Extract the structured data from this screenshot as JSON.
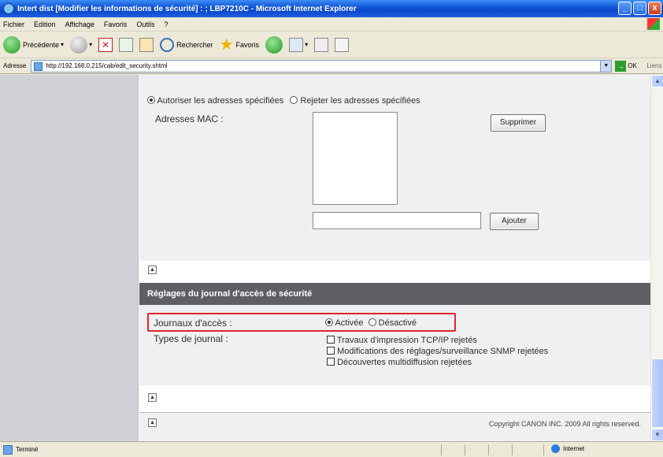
{
  "window": {
    "title": "Intert dist [Modifier les informations de sécurité] : ; LBP7210C - Microsoft Internet Explorer",
    "btn_min": "_",
    "btn_max": "□",
    "btn_close": "x"
  },
  "menu": [
    "Fichier",
    "Edition",
    "Affichage",
    "Favoris",
    "Outils",
    "?"
  ],
  "toolbar": {
    "back_label": "Précédente",
    "search_label": "Rechercher",
    "favorites_label": "Favoris"
  },
  "addressbar": {
    "label": "Adresse",
    "url": "http://192.168.0.215/cab/edit_security.shtml",
    "go_label": "OK",
    "links_label": "Liens"
  },
  "mac_section": {
    "radio_allow": "Autoriser les adresses spécifiées",
    "radio_reject": "Rejeter les adresses spécifiées",
    "mac_label": "Adresses MAC :",
    "delete_button": "Supprimer",
    "add_input_value": "",
    "add_button": "Ajouter"
  },
  "log_section": {
    "header": "Réglages du journal d'accès de sécurité",
    "access_logs_label": "Journaux d'accès :",
    "radio_on": "Activée",
    "radio_off": "Désactivé",
    "log_types_label": "Types de journal :",
    "checkboxes": [
      "Travaux d'impression TCP/IP rejetés",
      "Modifications des réglages/surveillance SNMP rejetées",
      "Découvertes multidiffusion rejetées"
    ]
  },
  "footer": {
    "copyright": "Copyright CANON INC. 2009 All rights reserved."
  },
  "statusbar": {
    "status": "Terminé",
    "zone": "Internet"
  },
  "state": {
    "mac_filter": "allow",
    "access_log": "on"
  }
}
